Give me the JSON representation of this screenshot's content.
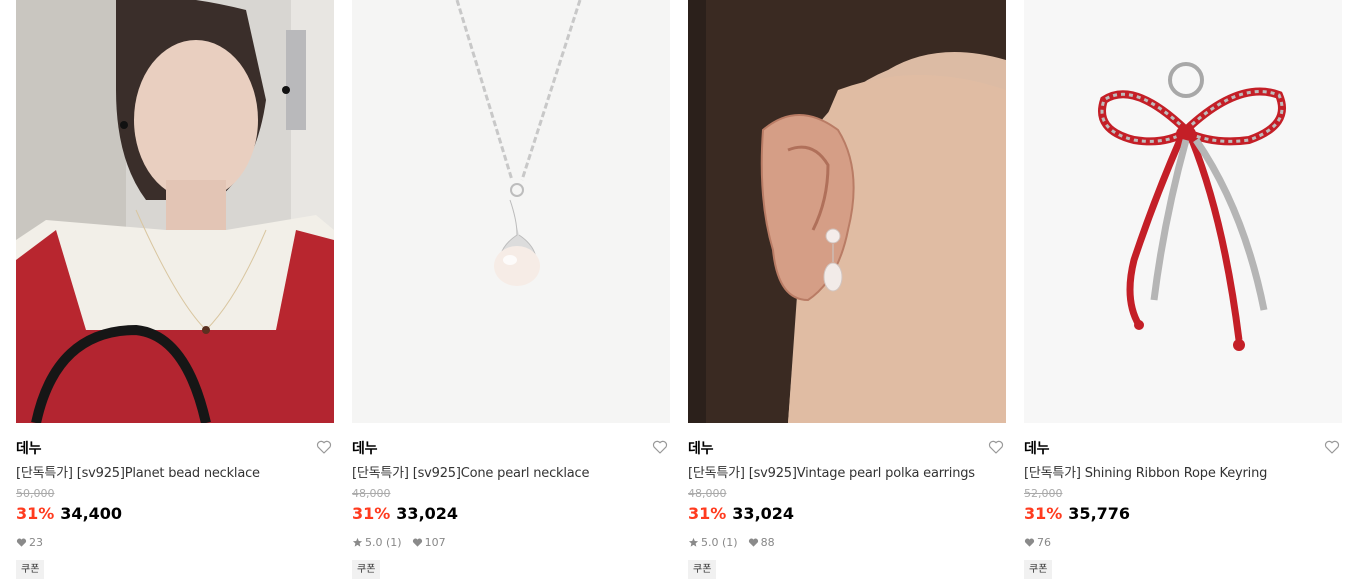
{
  "products": [
    {
      "brand": "데누",
      "name": "[단독특가] [sv925]Planet bead necklace",
      "original_price": "50,000",
      "discount": "31%",
      "price": "34,400",
      "likes": "23",
      "coupon": "쿠폰"
    },
    {
      "brand": "데누",
      "name": "[단독특가] [sv925]Cone pearl necklace",
      "original_price": "48,000",
      "discount": "31%",
      "price": "33,024",
      "rating": "5.0 (1)",
      "likes": "107",
      "coupon": "쿠폰"
    },
    {
      "brand": "데누",
      "name": "[단독특가] [sv925]Vintage pearl polka earrings",
      "original_price": "48,000",
      "discount": "31%",
      "price": "33,024",
      "rating": "5.0 (1)",
      "likes": "88",
      "coupon": "쿠폰"
    },
    {
      "brand": "데누",
      "name": "[단독특가] Shining Ribbon Rope Keyring",
      "original_price": "52,000",
      "discount": "31%",
      "price": "35,776",
      "likes": "76",
      "coupon": "쿠폰"
    }
  ],
  "colors": {
    "discount": "#ff3b1f",
    "original_price": "#aaaaaa",
    "coupon_bg": "#f1f1f1"
  },
  "icons": {
    "wishlist": "heart-outline-icon",
    "likes": "heart-filled-icon",
    "rating": "star-icon"
  }
}
